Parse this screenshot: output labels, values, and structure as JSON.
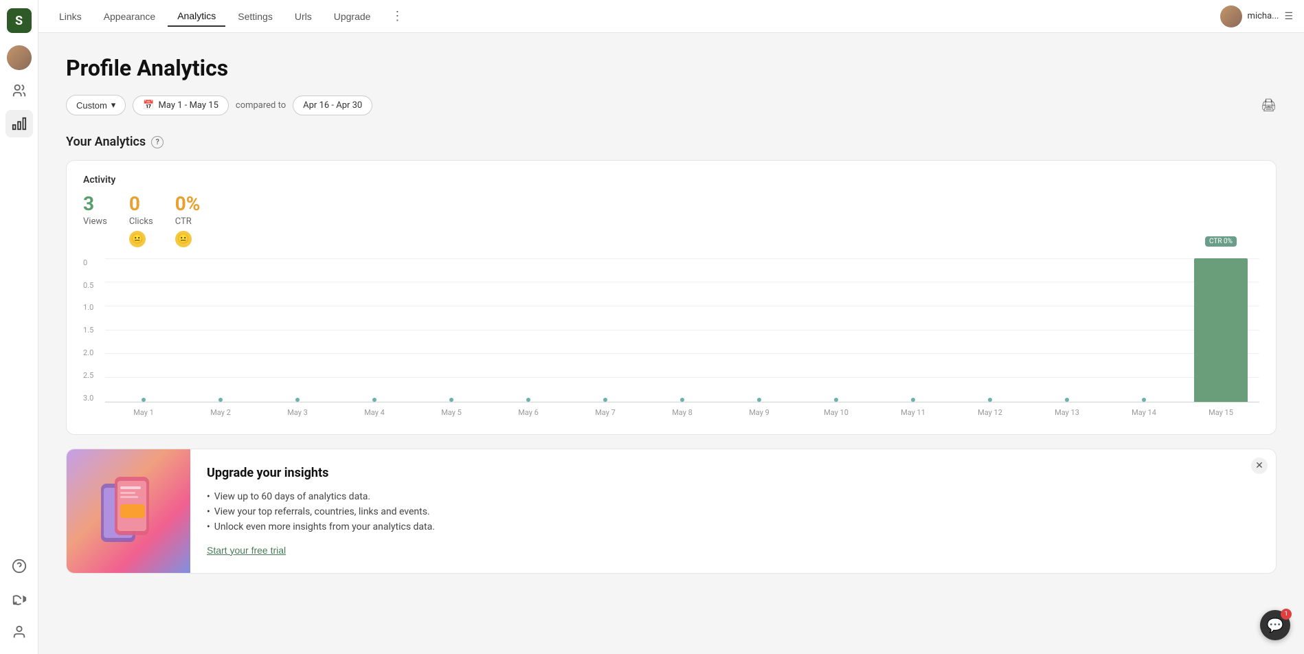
{
  "app": {
    "logo": "S",
    "logoColor": "#2d5a27"
  },
  "topnav": {
    "tabs": [
      {
        "id": "links",
        "label": "Links",
        "active": false
      },
      {
        "id": "appearance",
        "label": "Appearance",
        "active": false
      },
      {
        "id": "analytics",
        "label": "Analytics",
        "active": true
      },
      {
        "id": "settings",
        "label": "Settings",
        "active": false
      },
      {
        "id": "urls",
        "label": "Urls",
        "active": false
      },
      {
        "id": "upgrade",
        "label": "Upgrade",
        "active": false
      }
    ],
    "username": "micha...",
    "more_icon": "⋮",
    "menu_icon": "☰"
  },
  "sidebar": {
    "icons": [
      {
        "id": "user-avatar",
        "icon": "👤"
      },
      {
        "id": "people-icon",
        "icon": "👥"
      },
      {
        "id": "chart-icon",
        "icon": "📊"
      },
      {
        "id": "help-circle-icon",
        "icon": "?"
      },
      {
        "id": "megaphone-icon",
        "icon": "📣"
      },
      {
        "id": "profile-icon",
        "icon": "👤"
      }
    ]
  },
  "page": {
    "title": "Profile Analytics",
    "analytics_section_label": "Your Analytics",
    "help_tooltip": "?",
    "filter": {
      "custom_label": "Custom",
      "custom_dropdown": "▾",
      "calendar_icon": "📅",
      "date_range": "May 1 - May 15",
      "compared_to": "compared to",
      "comparison_range": "Apr 16 - Apr 30"
    },
    "print_icon": "🖨",
    "activity": {
      "label": "Activity",
      "stats": [
        {
          "id": "views",
          "value": "3",
          "label": "Views",
          "color": "green",
          "badge": null
        },
        {
          "id": "clicks",
          "value": "0",
          "label": "Clicks",
          "color": "orange",
          "badge": "😐"
        },
        {
          "id": "ctr",
          "value": "0%",
          "label": "CTR",
          "color": "orange-ctr",
          "badge": "😐"
        }
      ],
      "chart": {
        "y_labels": [
          "0",
          "0.5",
          "1.0",
          "1.5",
          "2.0",
          "2.5",
          "3.0"
        ],
        "x_labels": [
          "May 1",
          "May 2",
          "May 3",
          "May 4",
          "May 5",
          "May 6",
          "May 7",
          "May 8",
          "May 9",
          "May 10",
          "May 11",
          "May 12",
          "May 13",
          "May 14",
          "May 15"
        ],
        "bar_index": 14,
        "bar_height_pct": 100,
        "tooltip": "CTR 0%",
        "bar_color": "#6a9e7a"
      }
    },
    "upgrade": {
      "title": "Upgrade your insights",
      "bullets": [
        "View up to 60 days of analytics data.",
        "View your top referrals, countries, links and events.",
        "Unlock even more insights from your analytics data."
      ],
      "cta": "Start your free trial"
    }
  },
  "chat": {
    "badge": "1",
    "icon": "💬"
  }
}
